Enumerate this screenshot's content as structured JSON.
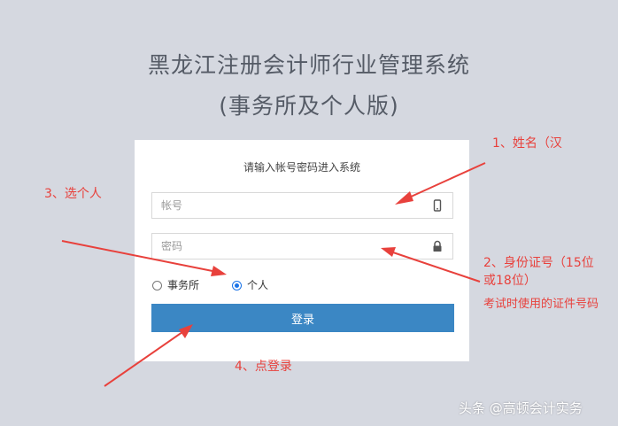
{
  "page": {
    "title_line1": "黑龙江注册会计师行业管理系统",
    "title_line2": "(事务所及个人版)"
  },
  "login": {
    "hint": "请输入帐号密码进入系统",
    "account_placeholder": "帐号",
    "password_placeholder": "密码",
    "radio_firm": "事务所",
    "radio_individual": "个人",
    "selected": "个人",
    "submit_label": "登录"
  },
  "annotations": {
    "a1": "1、姓名（汉",
    "a2_line1": "2、身份证号（15位",
    "a2_line2": "或18位）",
    "a2_line3": "考试时使用的证件号码",
    "a3": "3、选个人",
    "a4": "4、点登录",
    "color": "#e8413c"
  },
  "watermark": "头条 @高顿会计实务",
  "icons": {
    "account": "mobile-phone-icon",
    "password": "lock-icon"
  }
}
